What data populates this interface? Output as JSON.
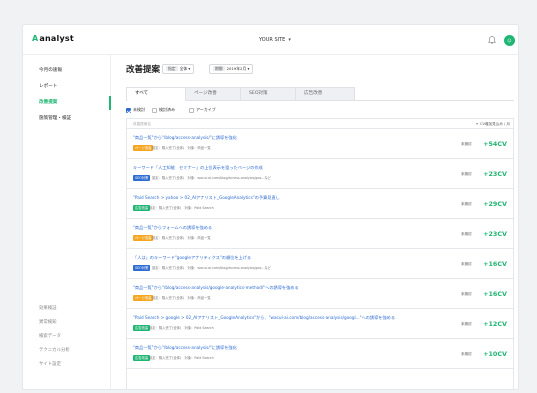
{
  "header": {
    "logo": "analyst",
    "site_selector": "YOUR SITE",
    "avatar": "☺"
  },
  "sidebar": {
    "items": [
      {
        "label": "今月の速報",
        "active": false
      },
      {
        "label": "レポート",
        "active": false
      },
      {
        "label": "改善提案",
        "active": true
      },
      {
        "label": "施策管理・検証",
        "active": false
      }
    ],
    "bottom_items": [
      {
        "label": "効果検証"
      },
      {
        "label": "異常検知"
      },
      {
        "label": "検索データ"
      },
      {
        "label": "テクニカル分析"
      },
      {
        "label": "サイト設定"
      }
    ]
  },
  "main": {
    "title": "改善提案",
    "filters": [
      {
        "label": "指定",
        "value": "全体"
      },
      {
        "label": "期間",
        "value": "2019年2月"
      }
    ],
    "tabs": [
      {
        "label": "すべて",
        "active": true
      },
      {
        "label": "ページ改善",
        "active": false
      },
      {
        "label": "SEO対策",
        "active": false
      },
      {
        "label": "広告改善",
        "active": false
      }
    ],
    "checkboxes": [
      {
        "label": "未検討",
        "checked": true
      },
      {
        "label": "検討済み",
        "checked": false
      },
      {
        "label": "アーカイブ",
        "checked": false
      }
    ],
    "table": {
      "header_name": "改善提案名",
      "header_cv": "CV増加見込み / 月",
      "rows": [
        {
          "prefix": "",
          "title": "\"商品一覧\"から\"/blog/access-analysis/\"に誘導を強化",
          "tag": "ページ改善",
          "tag_color": "#f5a623",
          "meta": "設定：購入完了(全体)　対象：商品一覧",
          "status": "未検討",
          "cv": "+54CV"
        },
        {
          "prefix": "",
          "title": "キーワード「人工知能　セミナー」の上位表示を狙ったページの作成",
          "tag": "SEO対策",
          "tag_color": "#2e6cd1",
          "meta": "設定：購入完了(全体)　対象：wacul-ai.com/blog/access-analysis/goo...など",
          "status": "未検討",
          "cv": "+23CV"
        },
        {
          "prefix": "",
          "title": "\"Paid Search > yahoo > 02_AIアナリスト_GoogleAnalytics\"の予算見直し",
          "tag": "広告改善",
          "tag_color": "#1fb573",
          "meta": "設定：購入完了(全体)　対象：Paid Search",
          "status": "未検討",
          "cv": "+29CV"
        },
        {
          "prefix": "",
          "title": "\"商品一覧\"からフォームへの誘導を強める",
          "tag": "ページ改善",
          "tag_color": "#f5a623",
          "meta": "設定：購入完了(全体)　対象：商品一覧",
          "status": "未検討",
          "cv": "+23CV"
        },
        {
          "prefix": "",
          "title": "「人は」のキーワード\"googleアナリティクス\"の順位を上げる",
          "tag": "SEO対策",
          "tag_color": "#2e6cd1",
          "meta": "設定：購入完了(全体)　対象：wacul-ai.com/blog/access-analysis/goo...など",
          "status": "未検討",
          "cv": "+16CV"
        },
        {
          "prefix": "",
          "title": "\"商品一覧\"から\"/blog/access-analysis/google-analytics-method/\"への誘導を強める",
          "tag": "ページ改善",
          "tag_color": "#f5a623",
          "meta": "設定：購入完了(全体)　対象：商品一覧",
          "status": "未検討",
          "cv": "+16CV"
        },
        {
          "prefix": "",
          "title": "\"Paid Search > google > 02_AIアナリスト_GoogleAnalytics\"から、\"wacul-ai.com/blog/access-analysis/googl...\"への誘導を強める",
          "tag": "広告改善",
          "tag_color": "#1fb573",
          "meta": "設定：購入完了(全体)　対象：Paid Search",
          "status": "未検討",
          "cv": "+12CV"
        },
        {
          "prefix": "",
          "title": "\"商品一覧\"から\"/blog/access-analysis/\"に誘導を強化",
          "tag": "広告改善",
          "tag_color": "#1fb573",
          "meta": "設定：購入完了(全体)　対象：Paid Search",
          "status": "未検討",
          "cv": "+10CV"
        }
      ]
    }
  }
}
